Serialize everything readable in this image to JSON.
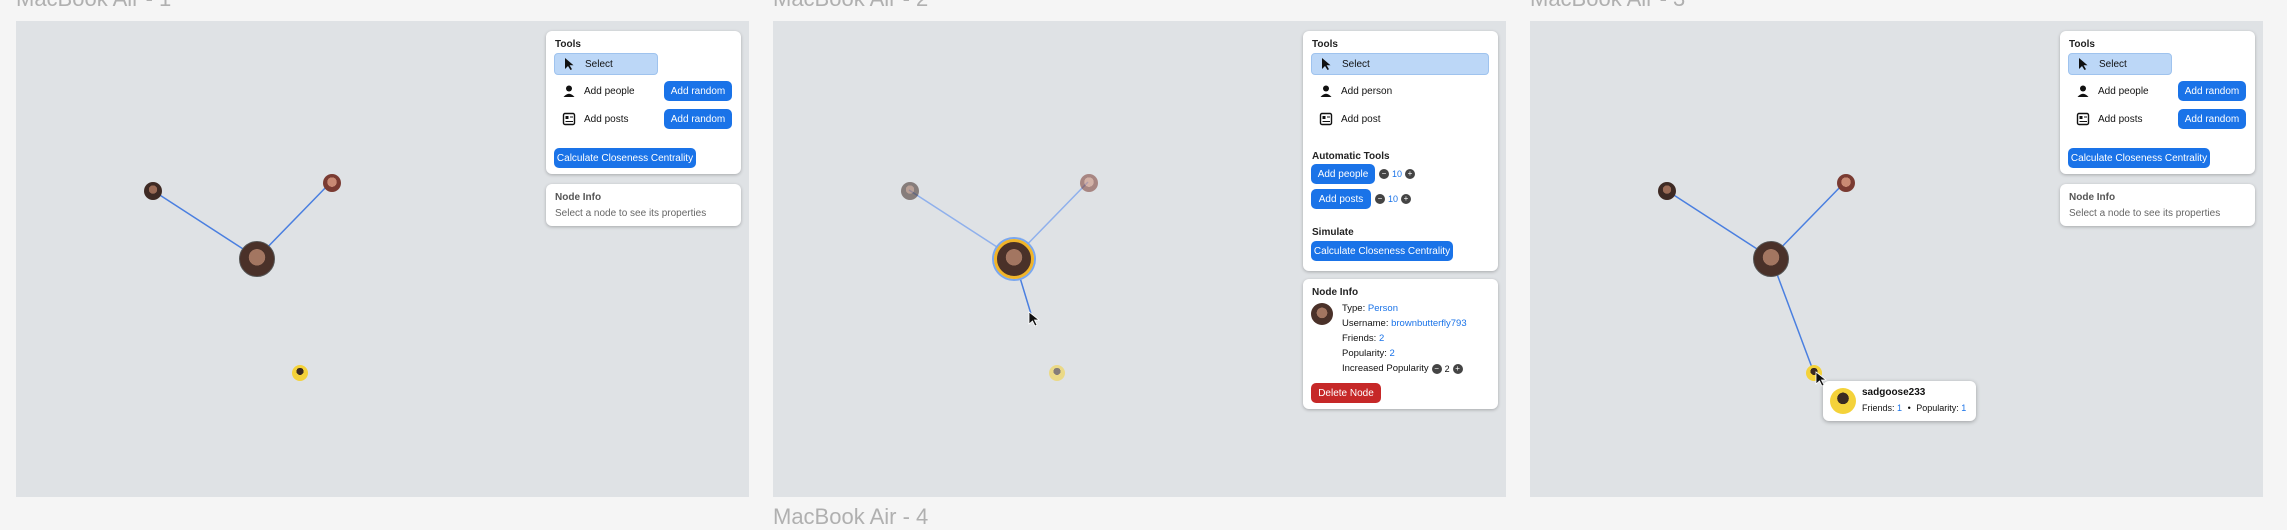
{
  "frames": [
    {
      "title": "MacBook Air - 1",
      "tools": {
        "title": "Tools",
        "select": "Select",
        "add_people": "Add people",
        "add_posts": "Add posts",
        "add_random": "Add random",
        "calc": "Calculate Closeness Centrality"
      },
      "node_info": {
        "title": "Node Info",
        "hint": "Select a node to see its properties"
      }
    },
    {
      "title": "MacBook Air - 2",
      "tools": {
        "title": "Tools",
        "select": "Select",
        "add_person": "Add person",
        "add_post": "Add post"
      },
      "automatic": {
        "title": "Automatic Tools",
        "add_people": "Add people",
        "add_posts": "Add posts",
        "people_count": "10",
        "posts_count": "10"
      },
      "simulate": {
        "title": "Simulate",
        "calc": "Calculate Closeness Centrality"
      },
      "node_info": {
        "title": "Node Info",
        "type_label": "Type:",
        "type_value": "Person",
        "username_label": "Username:",
        "username_value": "brownbutterfly793",
        "friends_label": "Friends:",
        "friends_value": "2",
        "popularity_label": "Popularity:",
        "popularity_value": "2",
        "increased_label": "Increased Popularity",
        "increased_value": "2",
        "delete": "Delete Node"
      }
    },
    {
      "title": "MacBook Air - 3",
      "tools": {
        "title": "Tools",
        "select": "Select",
        "add_people": "Add people",
        "add_posts": "Add posts",
        "add_random": "Add random",
        "calc": "Calculate Closeness Centrality"
      },
      "node_info": {
        "title": "Node Info",
        "hint": "Select a node to see its properties"
      },
      "tooltip": {
        "username": "sadgoose233",
        "friends_label": "Friends:",
        "friends_value": "1",
        "separator": "•",
        "popularity_label": "Popularity:",
        "popularity_value": "1"
      }
    }
  ],
  "bottom_title": "MacBook Air - 4",
  "colors": {
    "accent": "#1a73e8",
    "danger": "#c62828",
    "edge": "#4a7fe0",
    "canvas": "#dfe2e5",
    "select": "#bcd7f7"
  },
  "icons": [
    "cursor-icon",
    "person-icon",
    "posts-icon",
    "minus-icon",
    "plus-icon"
  ]
}
